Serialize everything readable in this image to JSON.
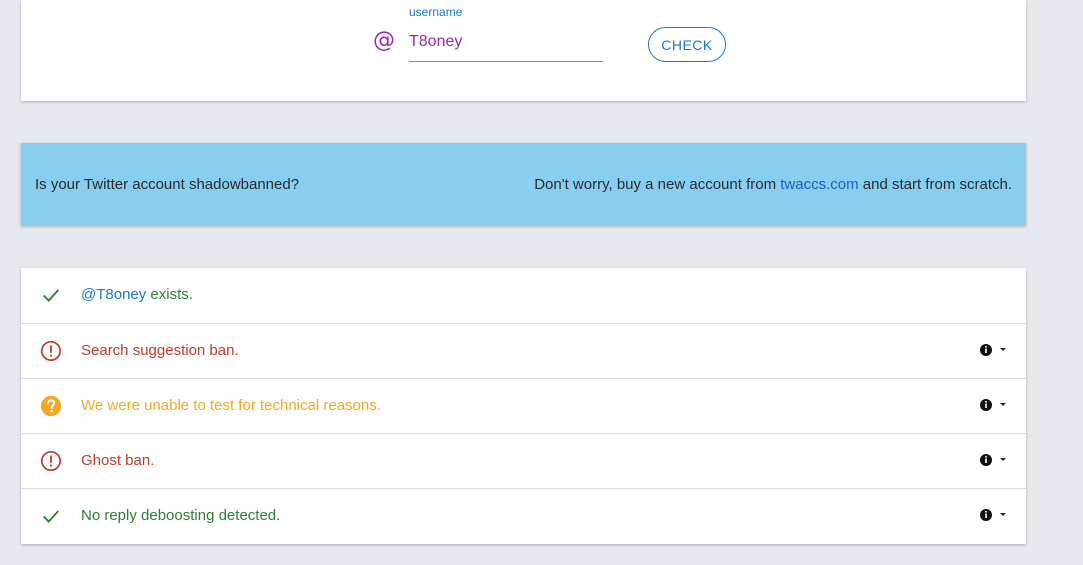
{
  "search": {
    "at_symbol": "@",
    "label": "username",
    "value": "T8oney",
    "button_label": "CHECK"
  },
  "banner": {
    "question": "Is your Twitter account shadowbanned?",
    "prefix": "Don't worry, buy a new account from ",
    "link_text": "twaccs.com",
    "suffix": " and start from scratch."
  },
  "results": {
    "exists_handle": "@T8oney",
    "exists_text": " exists.",
    "search_suggestion": "Search suggestion ban.",
    "technical": "We were unable to test for technical reasons.",
    "ghost": "Ghost ban.",
    "reply": "No reply deboosting detected."
  },
  "colors": {
    "accent": "#1976d2",
    "username": "#9c27b0",
    "ok": "#2e7d32",
    "ban": "#c0392b",
    "unknown": "#f5a623",
    "banner_bg": "#87cef0"
  }
}
